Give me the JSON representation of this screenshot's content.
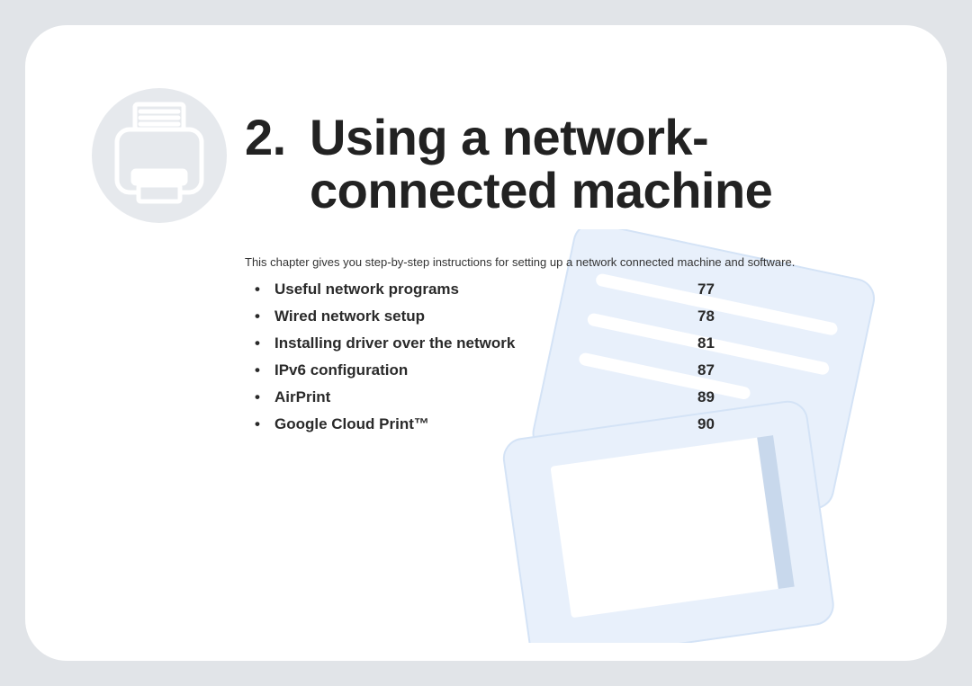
{
  "chapter": {
    "number": "2.",
    "title_line1": "Using a network-",
    "title_line2": "connected machine",
    "intro": "This chapter gives you step-by-step instructions for setting up a network connected machine and software."
  },
  "toc": [
    {
      "label": "Useful network programs",
      "page": "77"
    },
    {
      "label": "Wired network setup",
      "page": "78"
    },
    {
      "label": "Installing driver over the network",
      "page": "81"
    },
    {
      "label": "IPv6 configuration",
      "page": "87"
    },
    {
      "label": "AirPrint",
      "page": "89"
    },
    {
      "label": "Google Cloud Print™",
      "page": "90"
    }
  ]
}
